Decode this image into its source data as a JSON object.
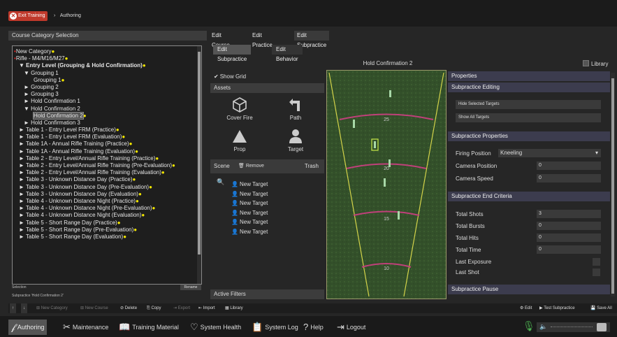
{
  "topbar": {
    "exit_label": "Exit Training",
    "breadcrumb": "Authoring"
  },
  "left_panel": {
    "title": "Course Category Selection",
    "tree": [
      {
        "label": "New Category",
        "indent": 0,
        "dot": true,
        "red": true,
        "bold": false
      },
      {
        "label": "Rifle - M4/M16/M27",
        "indent": 0,
        "dot": true,
        "red": true,
        "bold": false
      },
      {
        "label": "▼ Entry Level (Grouping & Hold Confirmation)",
        "indent": 1,
        "dot": true,
        "bold": true
      },
      {
        "label": "▼ Grouping 1",
        "indent": 2,
        "dot": false
      },
      {
        "label": "Grouping 1",
        "indent": 4,
        "dot": true
      },
      {
        "label": "► Grouping 2",
        "indent": 2,
        "dot": false
      },
      {
        "label": "► Grouping 3",
        "indent": 2,
        "dot": false
      },
      {
        "label": "► Hold Confirmation 1",
        "indent": 2,
        "dot": false
      },
      {
        "label": "▼ Hold Confirmation 2",
        "indent": 2,
        "dot": false
      },
      {
        "label": "Hold Confirmation 2",
        "indent": 4,
        "dot": true,
        "selected": true
      },
      {
        "label": "► Hold Confirmation 3",
        "indent": 2,
        "dot": false
      },
      {
        "label": "► Table 1 - Entry Level FRM (Practice)",
        "indent": 1,
        "dot": true
      },
      {
        "label": "► Table 1 - Entry Level FRM (Evaluation)",
        "indent": 1,
        "dot": true
      },
      {
        "label": "► Table 1A - Annual Rifle Training (Practice)",
        "indent": 1,
        "dot": true
      },
      {
        "label": "► Table 1A - Annual Rifle Training (Evaluation)",
        "indent": 1,
        "dot": true
      },
      {
        "label": "► Table 2 - Entry Level/Annual Rifle Training (Practice)",
        "indent": 1,
        "dot": true
      },
      {
        "label": "► Table 2 - Entry Level/Annual Rifle Training (Pre-Evaluation)",
        "indent": 1,
        "dot": true
      },
      {
        "label": "► Table 2 - Entry Level/Annual Rifle Training (Evaluation)",
        "indent": 1,
        "dot": true
      },
      {
        "label": "► Table 3 - Unknown Distance Day (Practice)",
        "indent": 1,
        "dot": true
      },
      {
        "label": "► Table 3 - Unknown Distance Day (Pre-Evaluation)",
        "indent": 1,
        "dot": true
      },
      {
        "label": "► Table 3 - Unknown Distance Day (Evaluation)",
        "indent": 1,
        "dot": true
      },
      {
        "label": "► Table 4 - Unknown Distance Night (Practice)",
        "indent": 1,
        "dot": true
      },
      {
        "label": "► Table 4 - Unknown Distance Night (Pre-Evaluation)",
        "indent": 1,
        "dot": true
      },
      {
        "label": "► Table 4 - Unknown Distance Night (Evaluation)",
        "indent": 1,
        "dot": true
      },
      {
        "label": "► Table 5 - Short Range Day (Practice)",
        "indent": 1,
        "dot": true
      },
      {
        "label": "► Table 5 - Short Range Day (Pre-Evaluation)",
        "indent": 1,
        "dot": true
      },
      {
        "label": "► Table 5 - Short Range Day (Evaluation)",
        "indent": 1,
        "dot": true
      }
    ],
    "selection_label": "Selection",
    "selection_value": "Subpractice 'Hold Confirmation 2'",
    "rename_label": "Rename"
  },
  "tabs": [
    "Edit Course",
    "Edit Practice",
    "Edit Subpractice"
  ],
  "subtabs": [
    "Edit Subpractice",
    "Edit Behavior"
  ],
  "subpractice_title": "Hold Confirmation 2",
  "library_label": "Library",
  "assets": {
    "show_grid": "Show Grid",
    "header": "Assets",
    "items": [
      "Cover Fire",
      "Path",
      "Prop",
      "Target"
    ]
  },
  "scene": {
    "label": "Scene",
    "remove": "Remove",
    "trash": "Trash",
    "items": [
      "New Target",
      "New Target",
      "New Target",
      "New Target",
      "New Target",
      "New Target"
    ]
  },
  "active_filters": "Active Filters",
  "map": {
    "distances": [
      "25",
      "20",
      "15",
      "10"
    ]
  },
  "properties": {
    "header": "Properties",
    "editing_header": "Subpractice Editing",
    "hide_btn": "Hide Selected Targets",
    "show_btn": "Show All Targets",
    "props_header": "Subpractice Properties",
    "firing_position_label": "Firing Position",
    "firing_position_value": "Kneeling",
    "camera_position_label": "Camera Position",
    "camera_position_value": "0",
    "camera_speed_label": "Camera Speed",
    "camera_speed_value": "0",
    "end_header": "Subpractice End Criteria",
    "total_shots_label": "Total Shots",
    "total_shots_value": "3",
    "total_bursts_label": "Total Bursts",
    "total_bursts_value": "0",
    "total_hits_label": "Total Hits",
    "total_hits_value": "0",
    "total_time_label": "Total Time",
    "total_time_value": "0",
    "last_exposure_label": "Last Exposure",
    "last_shot_label": "Last Shot",
    "pause_header": "Subpractice Pause"
  },
  "toolbar": {
    "new_category": "New Category",
    "new_course": "New Course",
    "delete": "Delete",
    "copy": "Copy",
    "export": "Export",
    "import": "Import",
    "library": "Library",
    "edit": "Edit",
    "test": "Test Subpractice",
    "save_all": "Save All"
  },
  "nav": [
    "Authoring",
    "Maintenance",
    "Training Material",
    "System Health",
    "System Log",
    "Help",
    "Logout"
  ]
}
